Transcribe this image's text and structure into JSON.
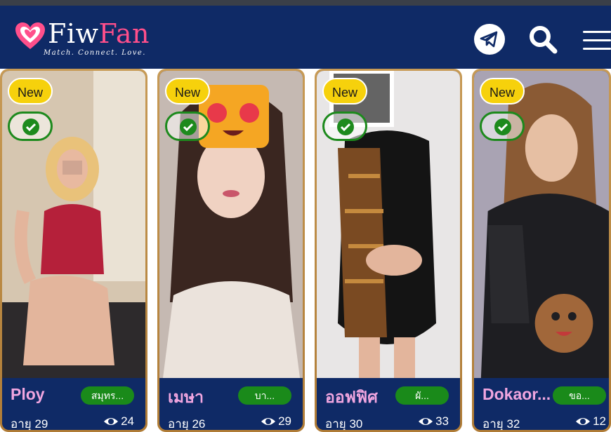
{
  "header": {
    "logo_text_a": "Fiw",
    "logo_text_b": "Fan",
    "tagline": "Match. Connect. Love.",
    "icons": [
      "telegram-icon",
      "search-icon",
      "menu-icon"
    ],
    "colors": {
      "bg": "#0f2a66",
      "brand_pink": "#ff4f8b"
    }
  },
  "cards": [
    {
      "badge": "New",
      "name": "Ploy",
      "location": "สมุทร...",
      "age": "อายุ 29",
      "views": "24"
    },
    {
      "badge": "New",
      "name": "เมษา",
      "location": "บา...",
      "age": "อายุ 26",
      "views": "29"
    },
    {
      "badge": "New",
      "name": "ออฟฟิศ",
      "location": "ผั...",
      "age": "อายุ 30",
      "views": "33"
    },
    {
      "badge": "New",
      "name": "Dokaor...",
      "location": "ขอ...",
      "age": "อายุ 32",
      "views": "12"
    }
  ],
  "colors": {
    "new_badge": "#f6d10c",
    "verified": "#1d8a1d",
    "location_pill": "#1a8a1a",
    "name": "#f1a6e0",
    "card_border": "#c79a55"
  }
}
